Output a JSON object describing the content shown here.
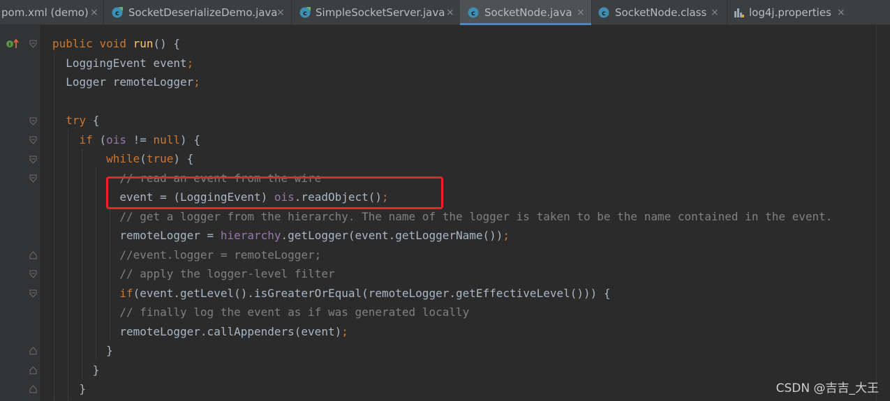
{
  "tabs": [
    {
      "label": "pom.xml (demo)",
      "icon": "maven-file-icon",
      "close": "×"
    },
    {
      "label": "SocketDeserializeDemo.java",
      "icon": "java-class-icon",
      "close": "×"
    },
    {
      "label": "SimpleSocketServer.java",
      "icon": "java-class-icon",
      "close": "×"
    },
    {
      "label": "SocketNode.java",
      "icon": "java-class-icon",
      "close": "×",
      "active": true
    },
    {
      "label": "SocketNode.class",
      "icon": "java-class-icon",
      "close": "×"
    },
    {
      "label": "log4j.properties",
      "icon": "properties-file-icon",
      "close": "×"
    }
  ],
  "editor": {
    "highlight_color": "#e8232a",
    "lines": [
      [
        {
          "c": "kw",
          "t": "public "
        },
        {
          "c": "kw",
          "t": "void "
        },
        {
          "c": "fn",
          "t": "run"
        },
        {
          "c": "pl",
          "t": "() {"
        }
      ],
      [
        {
          "c": "pl",
          "t": "  LoggingEvent event"
        },
        {
          "c": "kw",
          "t": ";"
        }
      ],
      [
        {
          "c": "pl",
          "t": "  Logger remoteLogger"
        },
        {
          "c": "kw",
          "t": ";"
        }
      ],
      [],
      [
        {
          "c": "kw",
          "t": "  try "
        },
        {
          "c": "pl",
          "t": "{"
        }
      ],
      [
        {
          "c": "kw",
          "t": "    if "
        },
        {
          "c": "pl",
          "t": "("
        },
        {
          "c": "fld",
          "t": "ois "
        },
        {
          "c": "pl",
          "t": "!= "
        },
        {
          "c": "kw",
          "t": "null"
        },
        {
          "c": "pl",
          "t": ") {"
        }
      ],
      [
        {
          "c": "kw",
          "t": "        while"
        },
        {
          "c": "pl",
          "t": "("
        },
        {
          "c": "kw",
          "t": "true"
        },
        {
          "c": "pl",
          "t": ") {"
        }
      ],
      [
        {
          "c": "cmt",
          "t": "          // read an event from the wire"
        }
      ],
      [
        {
          "c": "pl",
          "t": "          event = (LoggingEvent) "
        },
        {
          "c": "fld",
          "t": "ois"
        },
        {
          "c": "pl",
          "t": ".readObject()"
        },
        {
          "c": "kw",
          "t": ";"
        }
      ],
      [
        {
          "c": "cmt",
          "t": "          // get a logger from the hierarchy. The name of the logger is taken to be the name contained in the event."
        }
      ],
      [
        {
          "c": "pl",
          "t": "          remoteLogger = "
        },
        {
          "c": "fld",
          "t": "hierarchy"
        },
        {
          "c": "pl",
          "t": ".getLogger(event.getLoggerName())"
        },
        {
          "c": "kw",
          "t": ";"
        }
      ],
      [
        {
          "c": "cmt",
          "t": "          //event.logger = remoteLogger;"
        }
      ],
      [
        {
          "c": "cmt",
          "t": "          // apply the logger-level filter"
        }
      ],
      [
        {
          "c": "kw",
          "t": "          if"
        },
        {
          "c": "pl",
          "t": "(event.getLevel().isGreaterOrEqual(remoteLogger.getEffectiveLevel())) {"
        }
      ],
      [
        {
          "c": "cmt",
          "t": "          // finally log the event as if was generated locally"
        }
      ],
      [
        {
          "c": "pl",
          "t": "          remoteLogger.callAppenders(event)"
        },
        {
          "c": "kw",
          "t": ";"
        }
      ],
      [
        {
          "c": "pl",
          "t": "        }"
        }
      ],
      [
        {
          "c": "pl",
          "t": "      }"
        }
      ],
      [
        {
          "c": "pl",
          "t": "    }"
        }
      ]
    ]
  },
  "watermark": "CSDN @吉吉_大王"
}
